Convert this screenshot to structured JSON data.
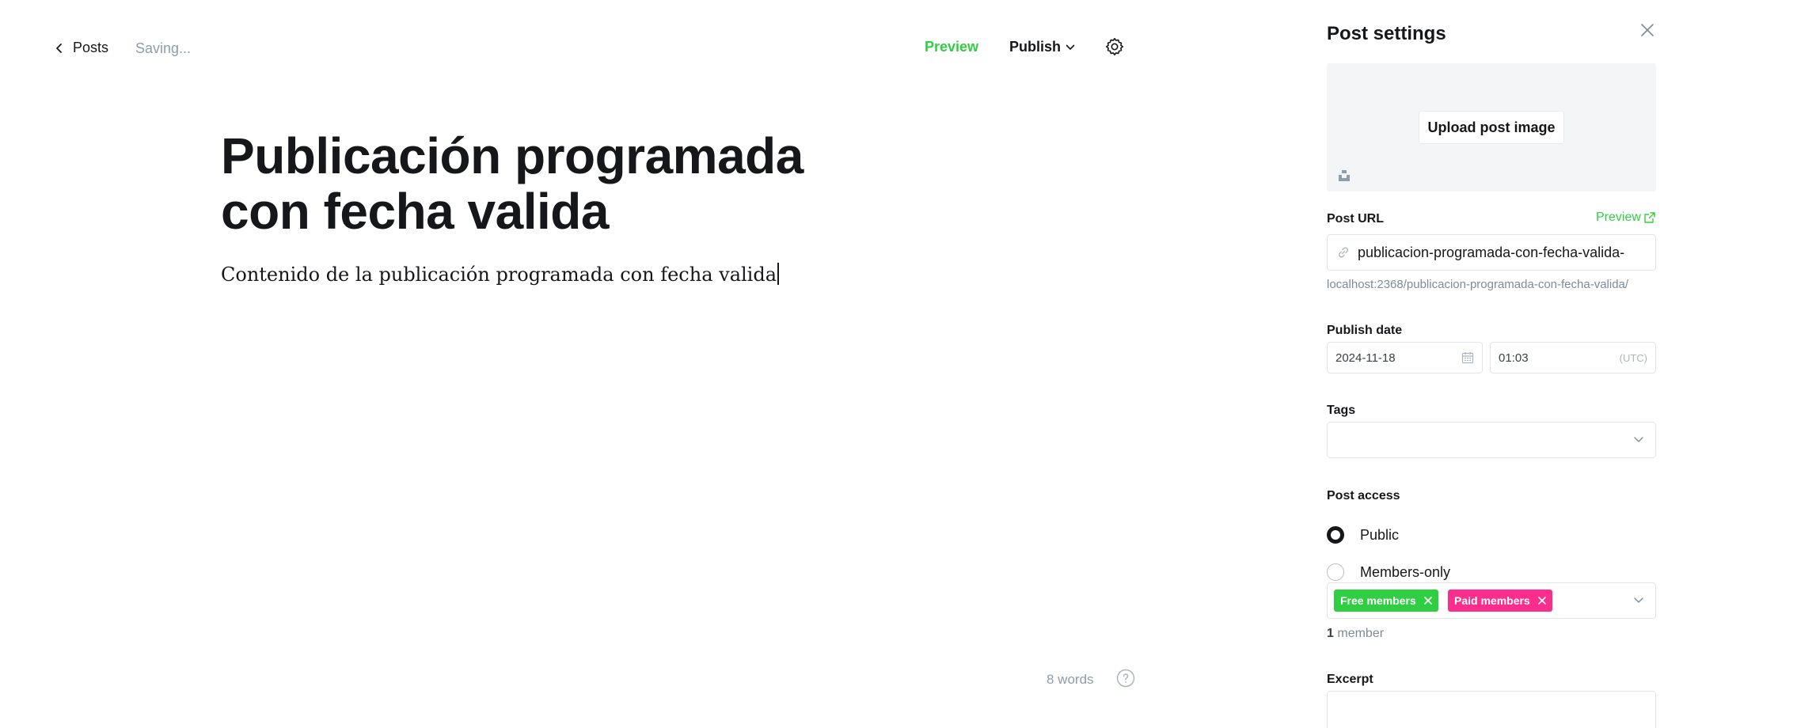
{
  "header": {
    "back_label": "Posts",
    "status": "Saving...",
    "preview_label": "Preview",
    "publish_label": "Publish"
  },
  "post": {
    "title": "Publicación programada con fecha valida",
    "body": "Contenido de la publicación programada con fecha valida"
  },
  "footer": {
    "word_count": "8 words"
  },
  "settings": {
    "title": "Post settings",
    "upload_label": "Upload post image",
    "post_url_label": "Post URL",
    "post_url_preview": "Preview",
    "slug": "publicacion-programada-con-fecha-valida-",
    "full_url": "localhost:2368/publicacion-programada-con-fecha-valida/",
    "publish_date_label": "Publish date",
    "date": "2024-11-18",
    "time": "01:03",
    "timezone": "(UTC)",
    "tags_label": "Tags",
    "post_access_label": "Post access",
    "access_options": [
      {
        "label": "Public",
        "selected": true
      },
      {
        "label": "Members-only",
        "selected": false
      }
    ],
    "segments": [
      {
        "label": "Free members",
        "color": "#30cf43"
      },
      {
        "label": "Paid members",
        "color": "#fb2d8d"
      }
    ],
    "member_count_number": "1",
    "member_count_suffix": "member",
    "excerpt_label": "Excerpt"
  },
  "colors": {
    "accent_green": "#30cf43",
    "accent_pink": "#fb2d8d",
    "text": "#15171a",
    "muted": "#8e9cac"
  }
}
